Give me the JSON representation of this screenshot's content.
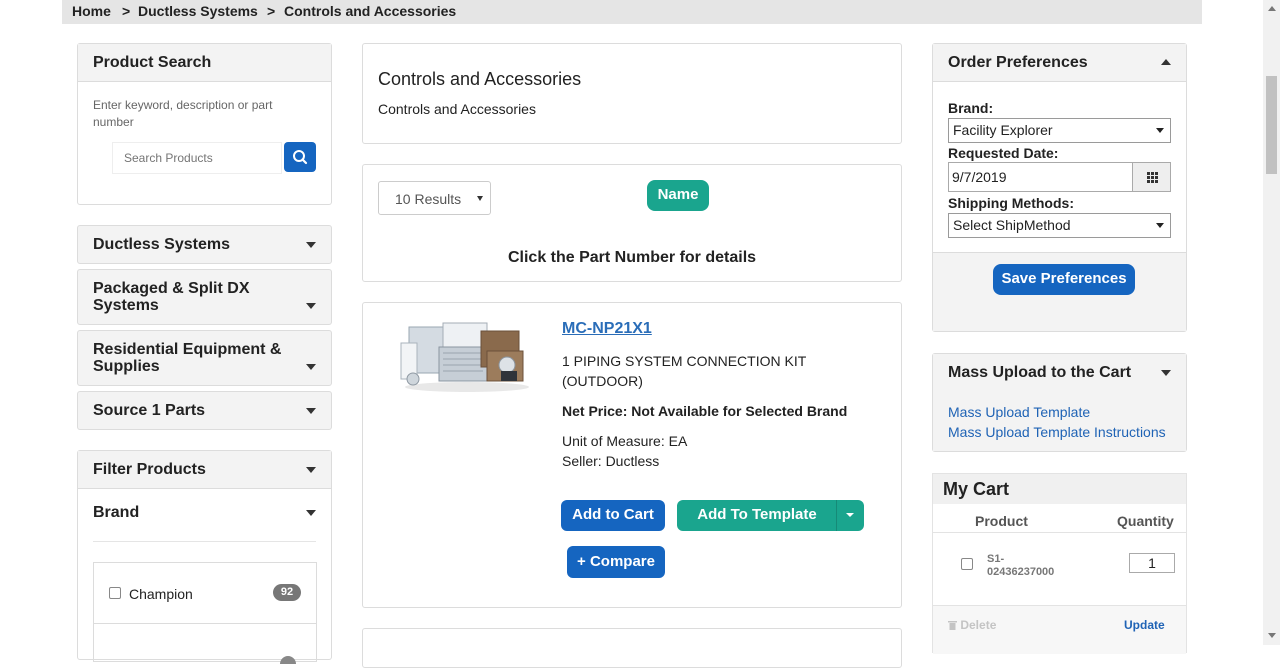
{
  "breadcrumb": {
    "home": "Home",
    "sep1": ">",
    "level1": "Ductless Systems",
    "sep2": ">",
    "level2": "Controls and Accessories"
  },
  "product_search": {
    "title": "Product Search",
    "hint": "Enter keyword, description or part number",
    "placeholder": "Search Products",
    "button_icon": "search-icon"
  },
  "categories": [
    {
      "label": "Ductless Systems"
    },
    {
      "label": "Packaged & Split DX Systems"
    },
    {
      "label": "Residential Equipment & Supplies"
    },
    {
      "label": "Source 1 Parts"
    }
  ],
  "filter": {
    "title": "Filter Products",
    "brand_title": "Brand",
    "items": [
      {
        "label": "Champion",
        "count": "92"
      }
    ]
  },
  "category_header": {
    "title": "Controls and Accessories",
    "description": "Controls and Accessories"
  },
  "results": {
    "select_value": "10 Results",
    "sort_label": "Name",
    "instruction": "Click the Part Number for details"
  },
  "product": {
    "part_number": "MC-NP21X1",
    "description": "1 PIPING SYSTEM CONNECTION KIT (OUTDOOR)",
    "net_price": "Net Price: Not Available for Selected Brand",
    "uom": "Unit of Measure: EA",
    "seller": "Seller: Ductless",
    "add_to_cart": "Add to Cart",
    "add_to_template": "Add To Template",
    "compare": "+ Compare"
  },
  "order_preferences": {
    "title": "Order Preferences",
    "brand_label": "Brand:",
    "brand_value": "Facility Explorer",
    "date_label": "Requested Date:",
    "date_value": "9/7/2019",
    "shipping_label": "Shipping Methods:",
    "shipping_value": "Select ShipMethod",
    "save_button": "Save Preferences"
  },
  "mass_upload": {
    "title": "Mass Upload to the Cart",
    "link1": "Mass Upload Template",
    "link2": "Mass Upload Template Instructions"
  },
  "cart": {
    "title": "My Cart",
    "col_product": "Product",
    "col_quantity": "Quantity",
    "items": [
      {
        "part_line1": "S1-",
        "part_line2": "02436237000",
        "quantity": "1"
      }
    ],
    "delete_label": "Delete",
    "update_label": "Update"
  },
  "colors": {
    "primary": "#1565c0",
    "teal": "#1aa58e",
    "link": "#1f63b5"
  }
}
